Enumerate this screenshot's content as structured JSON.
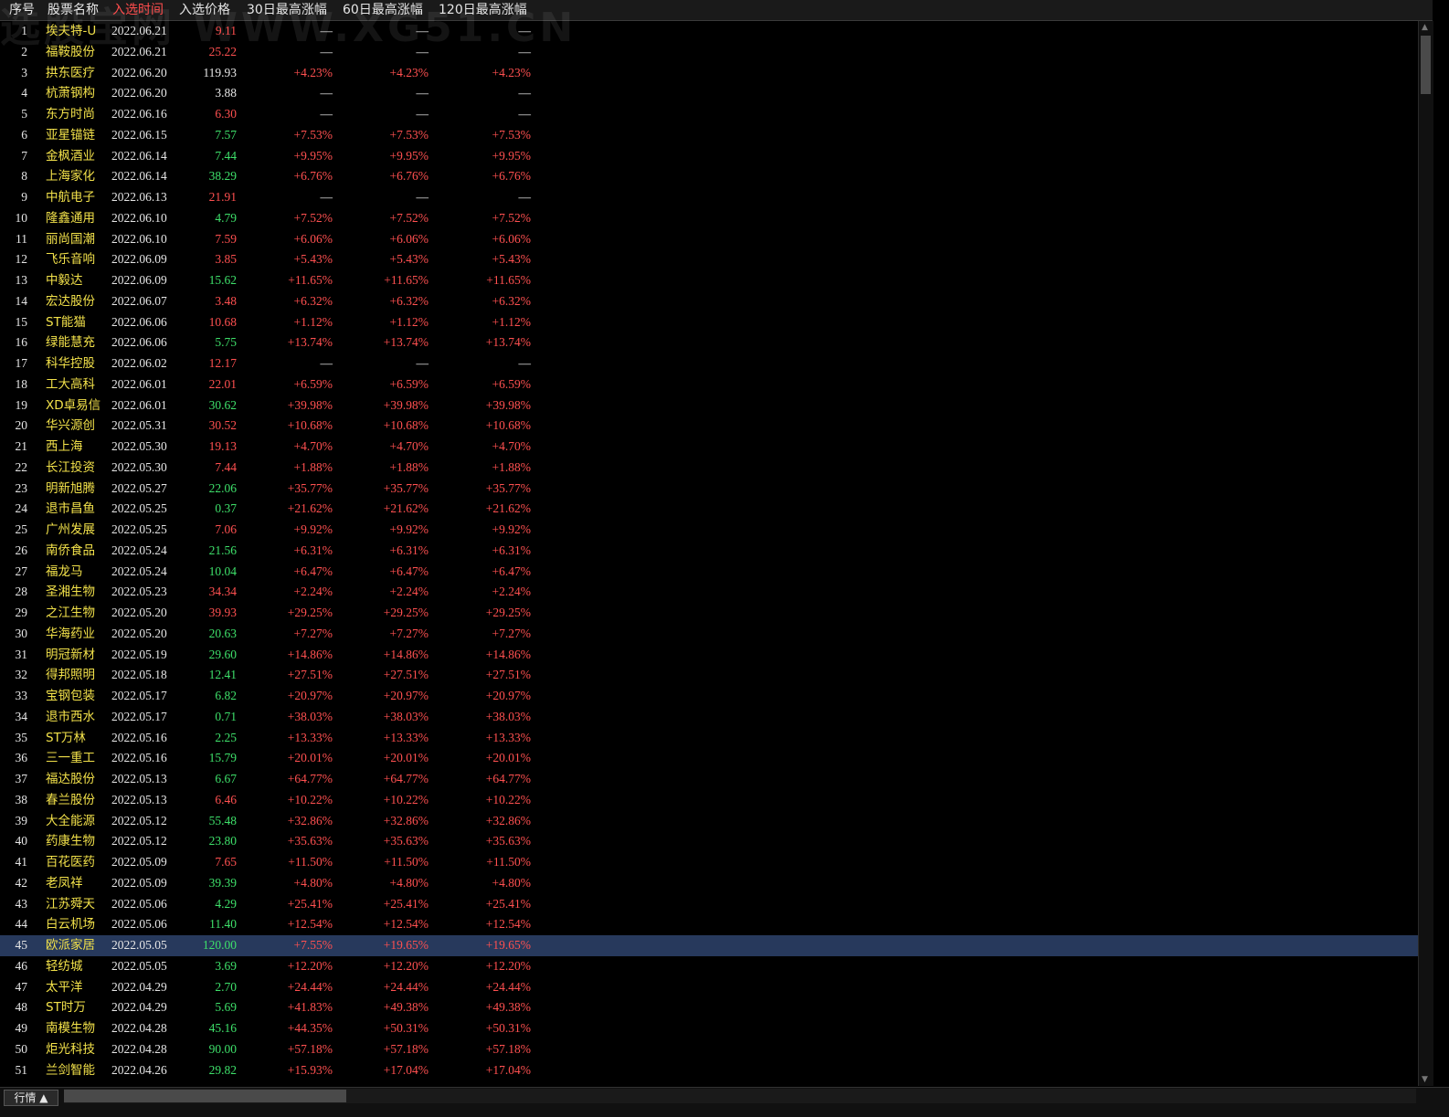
{
  "colors": {
    "up": "#ff5050",
    "down": "#3ee06a",
    "flat": "#e6e6e6",
    "name": "#f2e14a",
    "selected_row": "#27395c"
  },
  "header": {
    "columns": [
      {
        "label": "序号",
        "key": "idx"
      },
      {
        "label": "股票名称",
        "key": "name"
      },
      {
        "label": "入选时间",
        "key": "date",
        "active": true
      },
      {
        "label": "入选价格",
        "key": "price"
      },
      {
        "label": "30日最高涨幅",
        "key": "g30"
      },
      {
        "label": "60日最高涨幅",
        "key": "g60"
      },
      {
        "label": "120日最高涨幅",
        "key": "g120"
      }
    ],
    "watermark": "选股宝网 WWW.XG51.CN"
  },
  "rows": [
    {
      "idx": "1",
      "name": "埃夫特-U",
      "date": "2022.06.21",
      "price": "9.11",
      "pc": "up",
      "g30": "—",
      "g60": "—",
      "g120": "—"
    },
    {
      "idx": "2",
      "name": "福鞍股份",
      "date": "2022.06.21",
      "price": "25.22",
      "pc": "up",
      "g30": "—",
      "g60": "—",
      "g120": "—"
    },
    {
      "idx": "3",
      "name": "拱东医疗",
      "date": "2022.06.20",
      "price": "119.93",
      "pc": "flat",
      "g30": "+4.23%",
      "g60": "+4.23%",
      "g120": "+4.23%"
    },
    {
      "idx": "4",
      "name": "杭萧钢构",
      "date": "2022.06.20",
      "price": "3.88",
      "pc": "flat",
      "g30": "—",
      "g60": "—",
      "g120": "—"
    },
    {
      "idx": "5",
      "name": "东方时尚",
      "date": "2022.06.16",
      "price": "6.30",
      "pc": "up",
      "g30": "—",
      "g60": "—",
      "g120": "—"
    },
    {
      "idx": "6",
      "name": "亚星锚链",
      "date": "2022.06.15",
      "price": "7.57",
      "pc": "down",
      "g30": "+7.53%",
      "g60": "+7.53%",
      "g120": "+7.53%"
    },
    {
      "idx": "7",
      "name": "金枫酒业",
      "date": "2022.06.14",
      "price": "7.44",
      "pc": "down",
      "g30": "+9.95%",
      "g60": "+9.95%",
      "g120": "+9.95%"
    },
    {
      "idx": "8",
      "name": "上海家化",
      "date": "2022.06.14",
      "price": "38.29",
      "pc": "down",
      "g30": "+6.76%",
      "g60": "+6.76%",
      "g120": "+6.76%"
    },
    {
      "idx": "9",
      "name": "中航电子",
      "date": "2022.06.13",
      "price": "21.91",
      "pc": "up",
      "g30": "—",
      "g60": "—",
      "g120": "—"
    },
    {
      "idx": "10",
      "name": "隆鑫通用",
      "date": "2022.06.10",
      "price": "4.79",
      "pc": "down",
      "g30": "+7.52%",
      "g60": "+7.52%",
      "g120": "+7.52%"
    },
    {
      "idx": "11",
      "name": "丽尚国潮",
      "date": "2022.06.10",
      "price": "7.59",
      "pc": "up",
      "g30": "+6.06%",
      "g60": "+6.06%",
      "g120": "+6.06%"
    },
    {
      "idx": "12",
      "name": "飞乐音响",
      "date": "2022.06.09",
      "price": "3.85",
      "pc": "up",
      "g30": "+5.43%",
      "g60": "+5.43%",
      "g120": "+5.43%"
    },
    {
      "idx": "13",
      "name": "中毅达",
      "date": "2022.06.09",
      "price": "15.62",
      "pc": "down",
      "g30": "+11.65%",
      "g60": "+11.65%",
      "g120": "+11.65%"
    },
    {
      "idx": "14",
      "name": "宏达股份",
      "date": "2022.06.07",
      "price": "3.48",
      "pc": "up",
      "g30": "+6.32%",
      "g60": "+6.32%",
      "g120": "+6.32%"
    },
    {
      "idx": "15",
      "name": "ST能猫",
      "date": "2022.06.06",
      "price": "10.68",
      "pc": "up",
      "g30": "+1.12%",
      "g60": "+1.12%",
      "g120": "+1.12%"
    },
    {
      "idx": "16",
      "name": "绿能慧充",
      "date": "2022.06.06",
      "price": "5.75",
      "pc": "down",
      "g30": "+13.74%",
      "g60": "+13.74%",
      "g120": "+13.74%"
    },
    {
      "idx": "17",
      "name": "科华控股",
      "date": "2022.06.02",
      "price": "12.17",
      "pc": "up",
      "g30": "—",
      "g60": "—",
      "g120": "—"
    },
    {
      "idx": "18",
      "name": "工大高科",
      "date": "2022.06.01",
      "price": "22.01",
      "pc": "up",
      "g30": "+6.59%",
      "g60": "+6.59%",
      "g120": "+6.59%"
    },
    {
      "idx": "19",
      "name": "XD卓易信",
      "date": "2022.06.01",
      "price": "30.62",
      "pc": "down",
      "g30": "+39.98%",
      "g60": "+39.98%",
      "g120": "+39.98%"
    },
    {
      "idx": "20",
      "name": "华兴源创",
      "date": "2022.05.31",
      "price": "30.52",
      "pc": "up",
      "g30": "+10.68%",
      "g60": "+10.68%",
      "g120": "+10.68%"
    },
    {
      "idx": "21",
      "name": "西上海",
      "date": "2022.05.30",
      "price": "19.13",
      "pc": "up",
      "g30": "+4.70%",
      "g60": "+4.70%",
      "g120": "+4.70%"
    },
    {
      "idx": "22",
      "name": "长江投资",
      "date": "2022.05.30",
      "price": "7.44",
      "pc": "up",
      "g30": "+1.88%",
      "g60": "+1.88%",
      "g120": "+1.88%"
    },
    {
      "idx": "23",
      "name": "明新旭腾",
      "date": "2022.05.27",
      "price": "22.06",
      "pc": "down",
      "g30": "+35.77%",
      "g60": "+35.77%",
      "g120": "+35.77%"
    },
    {
      "idx": "24",
      "name": "退市昌鱼",
      "date": "2022.05.25",
      "price": "0.37",
      "pc": "down",
      "g30": "+21.62%",
      "g60": "+21.62%",
      "g120": "+21.62%"
    },
    {
      "idx": "25",
      "name": "广州发展",
      "date": "2022.05.25",
      "price": "7.06",
      "pc": "up",
      "g30": "+9.92%",
      "g60": "+9.92%",
      "g120": "+9.92%"
    },
    {
      "idx": "26",
      "name": "南侨食品",
      "date": "2022.05.24",
      "price": "21.56",
      "pc": "down",
      "g30": "+6.31%",
      "g60": "+6.31%",
      "g120": "+6.31%"
    },
    {
      "idx": "27",
      "name": "福龙马",
      "date": "2022.05.24",
      "price": "10.04",
      "pc": "down",
      "g30": "+6.47%",
      "g60": "+6.47%",
      "g120": "+6.47%"
    },
    {
      "idx": "28",
      "name": "圣湘生物",
      "date": "2022.05.23",
      "price": "34.34",
      "pc": "up",
      "g30": "+2.24%",
      "g60": "+2.24%",
      "g120": "+2.24%"
    },
    {
      "idx": "29",
      "name": "之江生物",
      "date": "2022.05.20",
      "price": "39.93",
      "pc": "up",
      "g30": "+29.25%",
      "g60": "+29.25%",
      "g120": "+29.25%"
    },
    {
      "idx": "30",
      "name": "华海药业",
      "date": "2022.05.20",
      "price": "20.63",
      "pc": "down",
      "g30": "+7.27%",
      "g60": "+7.27%",
      "g120": "+7.27%"
    },
    {
      "idx": "31",
      "name": "明冠新材",
      "date": "2022.05.19",
      "price": "29.60",
      "pc": "down",
      "g30": "+14.86%",
      "g60": "+14.86%",
      "g120": "+14.86%"
    },
    {
      "idx": "32",
      "name": "得邦照明",
      "date": "2022.05.18",
      "price": "12.41",
      "pc": "down",
      "g30": "+27.51%",
      "g60": "+27.51%",
      "g120": "+27.51%"
    },
    {
      "idx": "33",
      "name": "宝钢包装",
      "date": "2022.05.17",
      "price": "6.82",
      "pc": "down",
      "g30": "+20.97%",
      "g60": "+20.97%",
      "g120": "+20.97%"
    },
    {
      "idx": "34",
      "name": "退市西水",
      "date": "2022.05.17",
      "price": "0.71",
      "pc": "down",
      "g30": "+38.03%",
      "g60": "+38.03%",
      "g120": "+38.03%"
    },
    {
      "idx": "35",
      "name": "ST万林",
      "date": "2022.05.16",
      "price": "2.25",
      "pc": "down",
      "g30": "+13.33%",
      "g60": "+13.33%",
      "g120": "+13.33%"
    },
    {
      "idx": "36",
      "name": "三一重工",
      "date": "2022.05.16",
      "price": "15.79",
      "pc": "down",
      "g30": "+20.01%",
      "g60": "+20.01%",
      "g120": "+20.01%"
    },
    {
      "idx": "37",
      "name": "福达股份",
      "date": "2022.05.13",
      "price": "6.67",
      "pc": "down",
      "g30": "+64.77%",
      "g60": "+64.77%",
      "g120": "+64.77%"
    },
    {
      "idx": "38",
      "name": "春兰股份",
      "date": "2022.05.13",
      "price": "6.46",
      "pc": "up",
      "g30": "+10.22%",
      "g60": "+10.22%",
      "g120": "+10.22%"
    },
    {
      "idx": "39",
      "name": "大全能源",
      "date": "2022.05.12",
      "price": "55.48",
      "pc": "down",
      "g30": "+32.86%",
      "g60": "+32.86%",
      "g120": "+32.86%"
    },
    {
      "idx": "40",
      "name": "药康生物",
      "date": "2022.05.12",
      "price": "23.80",
      "pc": "down",
      "g30": "+35.63%",
      "g60": "+35.63%",
      "g120": "+35.63%"
    },
    {
      "idx": "41",
      "name": "百花医药",
      "date": "2022.05.09",
      "price": "7.65",
      "pc": "up",
      "g30": "+11.50%",
      "g60": "+11.50%",
      "g120": "+11.50%"
    },
    {
      "idx": "42",
      "name": "老凤祥",
      "date": "2022.05.09",
      "price": "39.39",
      "pc": "down",
      "g30": "+4.80%",
      "g60": "+4.80%",
      "g120": "+4.80%"
    },
    {
      "idx": "43",
      "name": "江苏舜天",
      "date": "2022.05.06",
      "price": "4.29",
      "pc": "down",
      "g30": "+25.41%",
      "g60": "+25.41%",
      "g120": "+25.41%"
    },
    {
      "idx": "44",
      "name": "白云机场",
      "date": "2022.05.06",
      "price": "11.40",
      "pc": "down",
      "g30": "+12.54%",
      "g60": "+12.54%",
      "g120": "+12.54%"
    },
    {
      "idx": "45",
      "name": "欧派家居",
      "date": "2022.05.05",
      "price": "120.00",
      "pc": "down",
      "g30": "+7.55%",
      "g60": "+19.65%",
      "g120": "+19.65%",
      "selected": true
    },
    {
      "idx": "46",
      "name": "轻纺城",
      "date": "2022.05.05",
      "price": "3.69",
      "pc": "down",
      "g30": "+12.20%",
      "g60": "+12.20%",
      "g120": "+12.20%"
    },
    {
      "idx": "47",
      "name": "太平洋",
      "date": "2022.04.29",
      "price": "2.70",
      "pc": "down",
      "g30": "+24.44%",
      "g60": "+24.44%",
      "g120": "+24.44%"
    },
    {
      "idx": "48",
      "name": "ST时万",
      "date": "2022.04.29",
      "price": "5.69",
      "pc": "down",
      "g30": "+41.83%",
      "g60": "+49.38%",
      "g120": "+49.38%"
    },
    {
      "idx": "49",
      "name": "南模生物",
      "date": "2022.04.28",
      "price": "45.16",
      "pc": "down",
      "g30": "+44.35%",
      "g60": "+50.31%",
      "g120": "+50.31%"
    },
    {
      "idx": "50",
      "name": "炬光科技",
      "date": "2022.04.28",
      "price": "90.00",
      "pc": "down",
      "g30": "+57.18%",
      "g60": "+57.18%",
      "g120": "+57.18%"
    },
    {
      "idx": "51",
      "name": "兰剑智能",
      "date": "2022.04.26",
      "price": "29.82",
      "pc": "down",
      "g30": "+15.93%",
      "g60": "+17.04%",
      "g120": "+17.04%"
    }
  ],
  "footer": {
    "tab_label": "行情 ▲"
  }
}
